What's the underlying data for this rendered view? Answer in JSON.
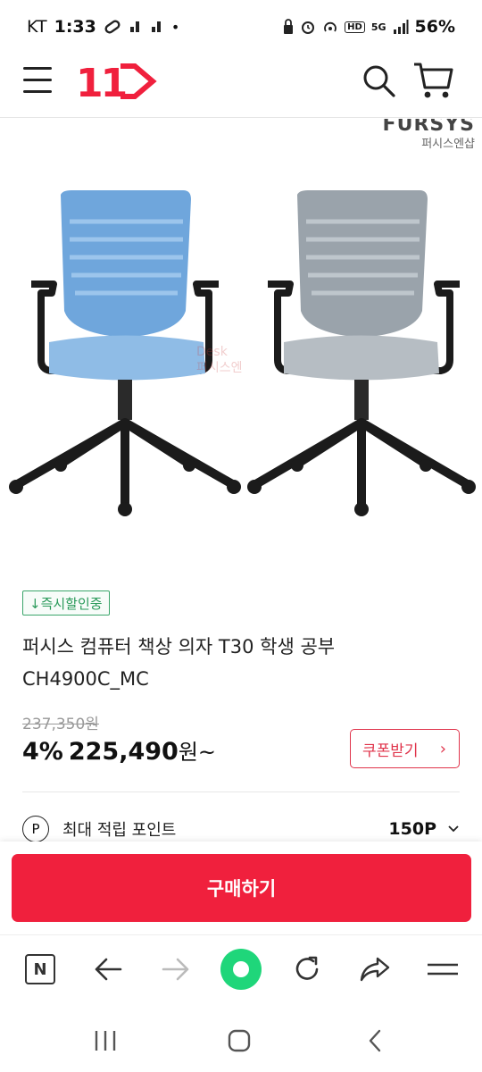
{
  "status_bar": {
    "carrier": "KT",
    "time": "1:33",
    "battery": "56%",
    "icons_left": [
      "link-icon",
      "notification-icon",
      "notification-icon",
      "dot-icon"
    ],
    "icons_right": [
      "lock-icon",
      "alarm-icon",
      "hotspot-icon",
      "hd-icon",
      "5g-icon",
      "signal-icon"
    ],
    "hd_label": "HD",
    "network_label": "5G"
  },
  "header": {
    "logo_text": "11",
    "brand_color": "#f0203d"
  },
  "product_image": {
    "brand_wordmark": "FURSYS",
    "brand_sub": "퍼시스엔샵",
    "watermark_line1": "Desk",
    "watermark_line2": "퍼시스엔",
    "chair_colors": [
      "#6fa6dc",
      "#9aa3ab"
    ]
  },
  "product": {
    "badge": "↓즉시할인중",
    "title_line1": "퍼시스 컴퓨터 책상 의자 T30 학생 공부",
    "title_line2": "CH4900C_MC",
    "original_price": "237,350원",
    "discount": "4%",
    "price": "225,490",
    "price_suffix": "원~",
    "coupon_label": "쿠폰받기",
    "points_icon": "P",
    "points_label": "최대 적립 포인트",
    "points_value": "150P"
  },
  "buy_button": "구매하기",
  "toolbar": {
    "items": [
      "n-icon",
      "back-icon",
      "forward-icon",
      "home-icon",
      "refresh-icon",
      "share-icon",
      "menu-icon"
    ],
    "n_label": "N"
  },
  "nav": [
    "recent-apps-icon",
    "home-button-icon",
    "back-nav-icon"
  ]
}
